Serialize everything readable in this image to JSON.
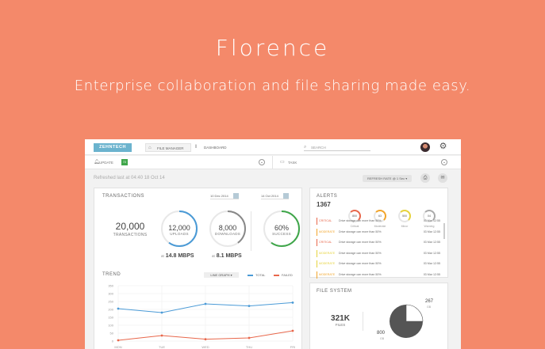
{
  "hero": {
    "title": "Florence",
    "subtitle": "Enterprise collaboration and file sharing made easy."
  },
  "topbar": {
    "brand": "ZEHNTECH",
    "nav": [
      {
        "label": "FILE MANAGER",
        "icon": "home-icon",
        "active": true
      },
      {
        "label": "DASHBOARD",
        "icon": "bars-icon",
        "active": false
      }
    ],
    "search_placeholder": "SEARCH",
    "search_icon": "search-icon",
    "avatar_icon": "user-avatar",
    "settings_icon": "gear-icon"
  },
  "subbar": {
    "left_label": "UPDATE",
    "left_badge": "72",
    "right_label": "TASK"
  },
  "status": {
    "refreshed_text": "Refreshed last at 04:40 18 Oct 14",
    "refresh_rate": "REFRESH RATE @ 1 Sec ▾"
  },
  "transactions": {
    "title": "TRANSACTIONS",
    "date_from": "10 Dec 2014",
    "date_to": "14 Oct 2014",
    "total_value": "20,000",
    "total_label": "TRANSACTIONS",
    "uploads_value": "12,000",
    "uploads_label": "UPLOADS",
    "uploads_fill": 0.6,
    "uploads_rate_prefix": "at",
    "uploads_rate": "14.8 MBPS",
    "downloads_value": "8,000",
    "downloads_label": "DOWNLOADS",
    "downloads_fill": 0.4,
    "downloads_rate_prefix": "at",
    "downloads_rate": "8.1 MBPS",
    "success_value": "60%",
    "success_label": "SUCCESS",
    "success_fill": 0.6
  },
  "trend": {
    "title": "TREND",
    "select_label": "LINE GRAPH ▾",
    "legend_total": "TOTAL",
    "legend_failed": "FAILED",
    "colors": {
      "total": "#4a9ad6",
      "failed": "#e8674b"
    }
  },
  "chart_data": {
    "type": "line",
    "categories": [
      "MON",
      "TUE",
      "WED",
      "THU",
      "FRI"
    ],
    "ylim": [
      0,
      350
    ],
    "yticks": [
      "0",
      "50",
      "100",
      "150",
      "200",
      "250",
      "300",
      "350"
    ],
    "series": [
      {
        "name": "TOTAL",
        "values": [
          205,
          180,
          235,
          222,
          243
        ]
      },
      {
        "name": "FAILED",
        "values": [
          5,
          35,
          12,
          20,
          65
        ]
      }
    ]
  },
  "alerts": {
    "title": "ALERTS",
    "count": "1367",
    "gauges": [
      {
        "value": "800",
        "label": "Critical",
        "color": "#e8674b"
      },
      {
        "value": "63",
        "label": "Moderate",
        "color": "#f2a52b"
      },
      {
        "value": "500",
        "label": "Minor",
        "color": "#e6d23c"
      },
      {
        "value": "04",
        "label": "Warning",
        "color": "#aaa"
      }
    ],
    "rows": [
      {
        "severity": "CRITICAL",
        "message": "Drive storage can more than 50%",
        "time": "03 Mar 12:55",
        "color": "#e8674b"
      },
      {
        "severity": "MODERATE",
        "message": "Drive storage can more than 50%",
        "time": "03 Mar 12:55",
        "color": "#f2a52b"
      },
      {
        "severity": "CRITICAL",
        "message": "Drive storage can more than 50%",
        "time": "03 Mar 12:55",
        "color": "#e8674b"
      },
      {
        "severity": "MODERATE",
        "message": "Drive storage can more than 50%",
        "time": "03 Mar 12:55",
        "color": "#e6d23c"
      },
      {
        "severity": "MODERATE",
        "message": "Drive storage can more than 50%",
        "time": "03 Mar 12:55",
        "color": "#e6d23c"
      },
      {
        "severity": "MODERATE",
        "message": "Drive storage can more than 50%",
        "time": "03 Mar 12:55",
        "color": "#f2a52b"
      }
    ]
  },
  "file_system": {
    "title": "FILE SYSTEM",
    "files_value": "321K",
    "files_label": "FILES",
    "slice_a_value": "267",
    "slice_a_label": "GB",
    "slice_b_value": "800",
    "slice_b_label": "GB",
    "slice_a_fraction": 0.25
  }
}
